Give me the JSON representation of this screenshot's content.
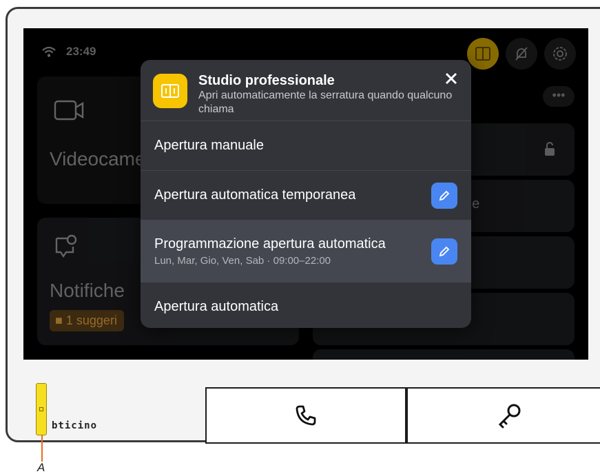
{
  "status": {
    "time": "23:49",
    "wifi_icon": "wifi-icon"
  },
  "top_icons": [
    "door-panel-icon",
    "bell-off-icon",
    "gear-icon"
  ],
  "background": {
    "video_label": "Videocame",
    "notify_label": "Notifiche",
    "hint_badge": "1 suggeri",
    "right_partial": "ge",
    "more_label": "•••"
  },
  "modal": {
    "title": "Studio professionale",
    "subtitle": "Apri automaticamente la serratura quando qualcuno chiama",
    "items": [
      {
        "label": "Apertura manuale",
        "sub": ""
      },
      {
        "label": "Apertura automatica temporanea",
        "sub": ""
      },
      {
        "label": "Programmazione apertura automatica",
        "sub": "Lun, Mar, Gio, Ven, Sab · 09:00–22:00"
      },
      {
        "label": "Apertura automatica",
        "sub": ""
      }
    ]
  },
  "device": {
    "brand": "bticino",
    "callout": "A"
  },
  "colors": {
    "accent_yellow": "#f6c400",
    "edit_blue": "#4a86f2",
    "callout_orange": "#f06a1a"
  }
}
